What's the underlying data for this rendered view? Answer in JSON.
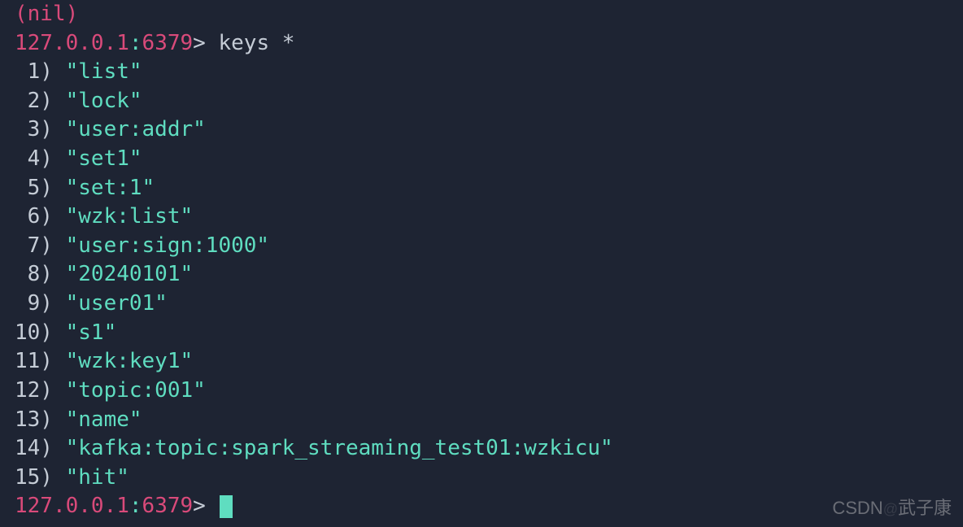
{
  "terminal": {
    "prev_output": "(nil)",
    "prompt_host": "127.0.0.1",
    "prompt_port": "6379",
    "prompt_arrow": ">",
    "command": "keys *",
    "results": [
      "\"list\"",
      "\"lock\"",
      "\"user:addr\"",
      "\"set1\"",
      "\"set:1\"",
      "\"wzk:list\"",
      "\"user:sign:1000\"",
      "\"20240101\"",
      "\"user01\"",
      "\"s1\"",
      "\"wzk:key1\"",
      "\"topic:001\"",
      "\"name\"",
      "\"kafka:topic:spark_streaming_test01:wzkicu\"",
      "\"hit\""
    ]
  },
  "watermark": {
    "site": "CSDN",
    "faint": "@",
    "author": "武子康"
  }
}
